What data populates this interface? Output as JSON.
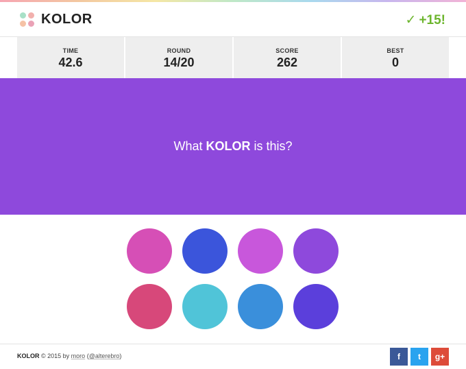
{
  "header": {
    "title": "KOLOR",
    "logo_colors": [
      "#a8e0c7",
      "#f2b0ad",
      "#f5c2a6",
      "#eaa2b6"
    ],
    "bonus_text": "+15!",
    "bonus_icon": "checkmark-icon",
    "bonus_color": "#6cb52d"
  },
  "stats": [
    {
      "label": "TIME",
      "value": "42.6"
    },
    {
      "label": "ROUND",
      "value": "14/20"
    },
    {
      "label": "SCORE",
      "value": "262"
    },
    {
      "label": "BEST",
      "value": "0"
    }
  ],
  "question": {
    "prefix": "What ",
    "highlight": "KOLOR",
    "suffix": " is this?",
    "background_color": "#8e49dc"
  },
  "options": [
    {
      "color": "#d64fb6"
    },
    {
      "color": "#3b55db"
    },
    {
      "color": "#c857db"
    },
    {
      "color": "#8e49dc"
    },
    {
      "color": "#d7487a"
    },
    {
      "color": "#50c4d8"
    },
    {
      "color": "#3a8fdb"
    },
    {
      "color": "#5b3fdb"
    }
  ],
  "footer": {
    "brand": "KOLOR",
    "copyright": " © 2015 by ",
    "author": "moro",
    "handle_open": " (",
    "handle": "@alterebro",
    "handle_close": ")"
  },
  "social": [
    {
      "icon": "facebook-icon",
      "glyph": "f",
      "color": "#3b5998"
    },
    {
      "icon": "twitter-icon",
      "glyph": "t",
      "color": "#2aa3ef"
    },
    {
      "icon": "google-plus-icon",
      "glyph": "g+",
      "color": "#dd4b39"
    }
  ]
}
